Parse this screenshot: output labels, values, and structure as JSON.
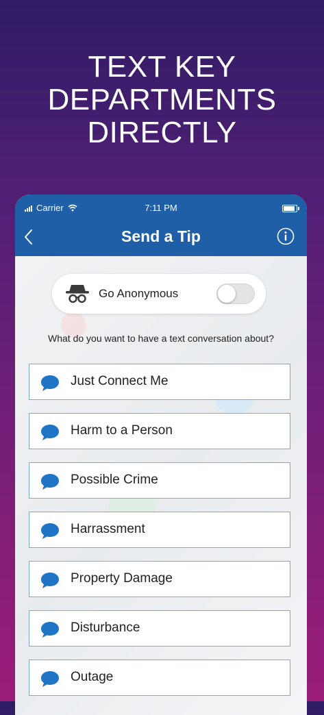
{
  "headline": {
    "line1": "TEXT KEY",
    "line2": "DEPARTMENTS",
    "line3": "DIRECTLY"
  },
  "status_bar": {
    "carrier": "Carrier",
    "time": "7:11 PM"
  },
  "nav": {
    "title": "Send a Tip",
    "back_icon": "chevron-left-icon",
    "info_icon": "info-circle-icon"
  },
  "anonymous": {
    "label": "Go Anonymous",
    "icon": "spy-icon",
    "enabled": false
  },
  "prompt": "What do you want to have a text conversation about?",
  "topics": [
    {
      "label": "Just Connect Me"
    },
    {
      "label": "Harm to a Person"
    },
    {
      "label": "Possible Crime"
    },
    {
      "label": "Harrassment"
    },
    {
      "label": "Property Damage"
    },
    {
      "label": "Disturbance"
    },
    {
      "label": "Outage"
    }
  ],
  "colors": {
    "nav_bar": "#1f5fa8",
    "topic_icon": "#1f74c6",
    "topic_border": "#7aa7d6"
  }
}
